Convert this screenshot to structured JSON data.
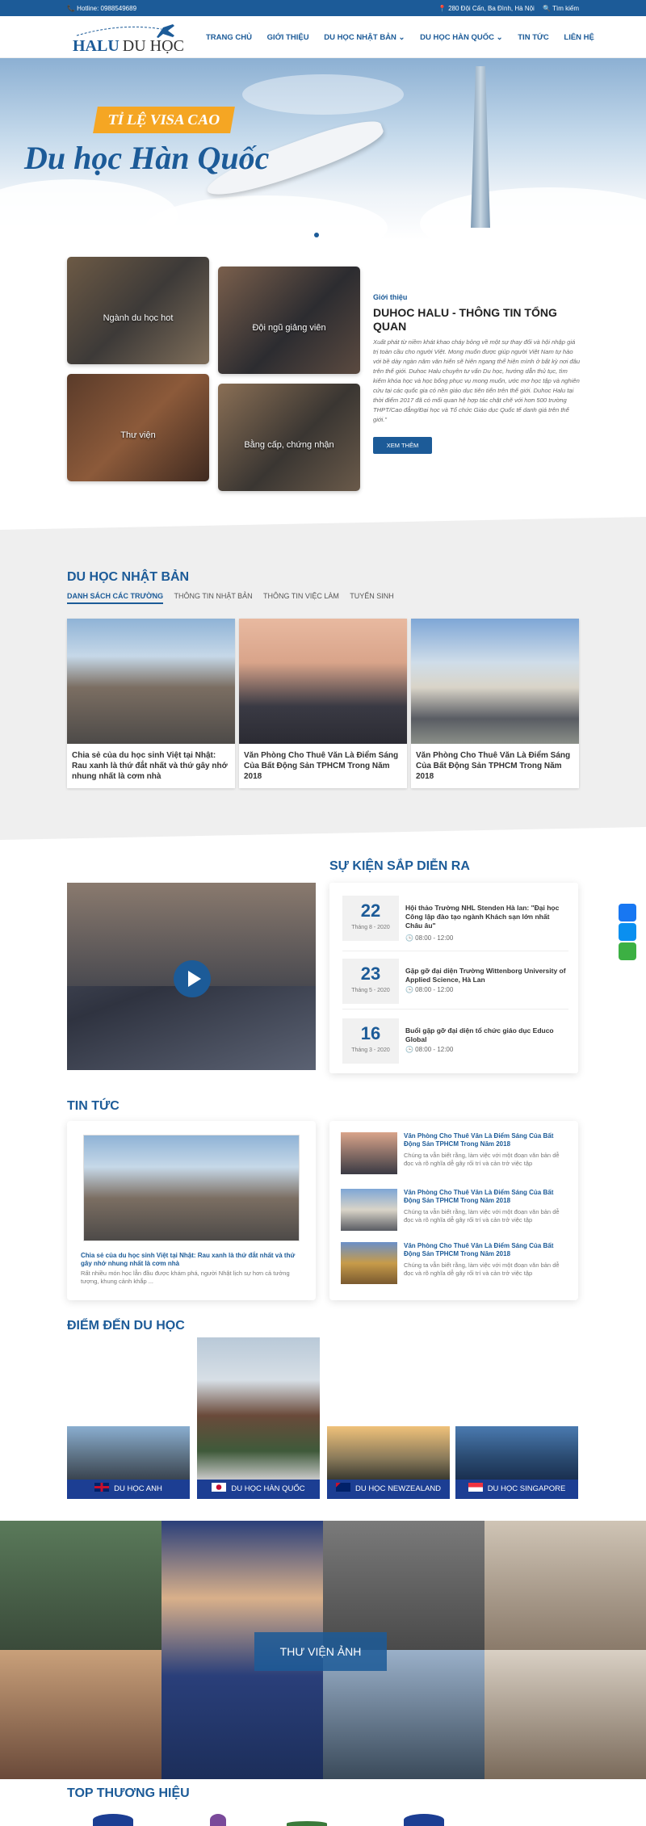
{
  "topbar": {
    "hotline": "📞 Hotline: 0988549689",
    "address": "📍 280 Đội Cấn, Ba Đình, Hà Nội",
    "search": "🔍 Tìm kiếm"
  },
  "logo": {
    "part1": "HALU",
    "part2": "DU HỌC",
    "icon": "airplane-icon"
  },
  "nav": [
    "TRANG CHỦ",
    "GIỚI THIỆU",
    "DU HỌC NHẬT BẢN ⌄",
    "DU HỌC HÀN QUỐC ⌄",
    "TIN TỨC",
    "LIÊN HỆ"
  ],
  "hero": {
    "badge": "TỈ LỆ VISA CAO",
    "title": "Du học Hàn Quốc"
  },
  "tiles": [
    "Ngành du học hot",
    "Đội ngũ giảng viên",
    "Thư viện",
    "Bằng cấp, chứng nhận"
  ],
  "about": {
    "label": "Giới thiệu",
    "title": "DUHOC HALU - THÔNG TIN TỔNG QUAN",
    "text": "Xuất phát từ niềm khát khao cháy bỏng về một sự thay đổi và hội nhập giá trị toàn cầu cho người Việt. Mong muốn được giúp người Việt Nam tự hào với bề dày ngàn năm văn hiến sẽ hiên ngang thể hiện mình ở bất kỳ nơi đâu trên thế giới. Duhoc Halu chuyên tư vấn Du học, hướng dẫn thủ tục, tìm kiếm khóa học và học bổng phục vụ mong muốn, ước mơ học tập và nghiên cứu tại các quốc gia có nền giáo dục tiên tiến trên thế giới. Duhoc Halu tại thời điểm 2017 đã có mối quan hệ hợp tác chặt chẽ với hơn 500 trường THPT/Cao đẳng/Đại học và Tổ chức Giáo dục Quốc tế danh giá trên thế giới.\"",
    "button": "XEM THÊM"
  },
  "japan": {
    "heading": "DU HỌC NHẬT BẢN",
    "tabs": [
      "DANH SÁCH CÁC TRƯỜNG",
      "THÔNG TIN NHẬT BẢN",
      "THÔNG TIN VIỆC LÀM",
      "TUYỂN SINH"
    ],
    "cards": [
      "Chia sẻ của du học sinh Việt tại Nhật: Rau xanh là thứ đắt nhất và thứ gây nhớ nhung nhất là cơm nhà",
      "Văn Phòng Cho Thuê Văn Là Điểm Sáng Của Bất Động Sản TPHCM Trong Năm 2018",
      "Văn Phòng Cho Thuê Văn Là Điểm Sáng Của Bất Động Sản TPHCM Trong Năm 2018"
    ]
  },
  "events": {
    "heading": "SỰ KIỆN SẮP DIỄN RA",
    "items": [
      {
        "day": "22",
        "month": "Tháng 8 - 2020",
        "title": "Hội thảo Trường NHL Stenden Hà lan: \"Đại học Công lập đào tạo ngành Khách sạn lớn nhất Châu âu\"",
        "time": "🕒 08:00 - 12:00"
      },
      {
        "day": "23",
        "month": "Tháng 5 - 2020",
        "title": "Gặp gỡ đại diện Trường Wittenborg University of Applied Science, Hà Lan",
        "time": "🕒 08:00 - 12:00"
      },
      {
        "day": "16",
        "month": "Tháng 3 - 2020",
        "title": "Buổi gặp gỡ đại diện tổ chức giáo dục Educo Global",
        "time": "🕒 08:00 - 12:00"
      }
    ]
  },
  "news": {
    "heading": "TIN TỨC",
    "featured": {
      "title": "Chia sẻ của du học sinh Việt tại Nhật: Rau xanh là thứ đắt nhất và thứ gây nhớ nhung nhất là cơm nhà",
      "desc": "Rất nhiều món học lẫn đầu được khám phá, người Nhật lịch sự hơn cả tưởng tượng, khung cảnh khắp ..."
    },
    "items": [
      {
        "title": "Văn Phòng Cho Thuê Văn Là Điểm Sáng Của Bất Động Sản TPHCM Trong Năm 2018",
        "desc": "Chúng ta vẫn biết rằng, làm việc với một đoạn văn bản dễ đọc và rõ nghĩa dễ gây rối trí và cản trở việc tập"
      },
      {
        "title": "Văn Phòng Cho Thuê Văn Là Điểm Sáng Của Bất Động Sản TPHCM Trong Năm 2018",
        "desc": "Chúng ta vẫn biết rằng, làm việc với một đoạn văn bản dễ đọc và rõ nghĩa dễ gây rối trí và cản trở việc tập"
      },
      {
        "title": "Văn Phòng Cho Thuê Văn Là Điểm Sáng Của Bất Động Sản TPHCM Trong Năm 2018",
        "desc": "Chúng ta vẫn biết rằng, làm việc với một đoạn văn bản dễ đọc và rõ nghĩa dễ gây rối trí và cản trở việc tập"
      }
    ]
  },
  "destinations": {
    "heading": "ĐIỂM ĐẾN DU HỌC",
    "items": [
      "DU HỌC ANH",
      "DU HỌC HÀN QUỐC",
      "DU HỌC NEWZEALAND",
      "DU HỌC SINGAPORE"
    ]
  },
  "library": {
    "label": "THƯ VIỆN ẢNH"
  },
  "brands": {
    "heading": "TOP THƯƠNG HIỆU"
  },
  "colors": {
    "primary": "#1c5b98",
    "accent": "#f5a623",
    "label_bg": "#1c3e93"
  }
}
